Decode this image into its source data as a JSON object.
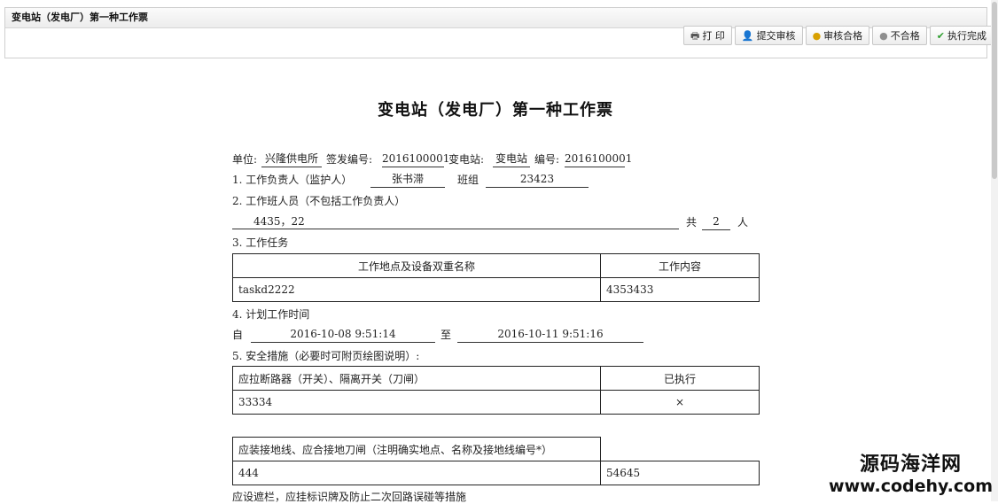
{
  "window": {
    "title": "变电站（发电厂）第一种工作票"
  },
  "toolbar": {
    "print": "打 印",
    "submit": "提交审核",
    "approve": "审核合格",
    "reject": "不合格",
    "complete": "执行完成"
  },
  "doc": {
    "title": "变电站（发电厂）第一种工作票",
    "header": {
      "unit_label": "单位:",
      "unit": "兴隆供电所",
      "issue_label": "签发编号:",
      "issue_no": "2016100001",
      "station_label": "变电站:",
      "station": "变电站",
      "no_label": "编号:",
      "no": "2016100001"
    },
    "s1": {
      "label": "1. 工作负责人（监护人）",
      "leader": "张书滞",
      "team_label": "班组",
      "team": "23423"
    },
    "s2": {
      "label": "2. 工作班人员（不包括工作负责人）",
      "members": "4435，22",
      "total_prefix": "共",
      "total": "2",
      "total_suffix": "人"
    },
    "s3": {
      "label": "3. 工作任务",
      "col_place": "工作地点及设备双重名称",
      "col_content": "工作内容",
      "rows": [
        {
          "place": "taskd2222",
          "content": "4353433"
        }
      ]
    },
    "s4": {
      "label": "4. 计划工作时间",
      "from_label": "自",
      "from": "2016-10-08 9:51:14",
      "to_label": "至",
      "to": "2016-10-11 9:51:16"
    },
    "s5": {
      "label": "5. 安全措施（必要时可附页绘图说明）:",
      "col_measure": "应拉断路器（开关）、隔离开关（刀闸）",
      "col_done": "已执行",
      "rows": [
        {
          "measure": "33334",
          "done": "×"
        }
      ],
      "col_ground": "应装接地线、应合接地刀闸（注明确实地点、名称及接地线编号*）",
      "ground_rows": [
        {
          "left": "444",
          "right": "54645"
        }
      ],
      "next_label": "应设遮栏，应挂标识牌及防止二次回路误碰等措施"
    }
  },
  "watermark": {
    "line1": "源码海洋网",
    "line2": "www.codehy.com"
  }
}
